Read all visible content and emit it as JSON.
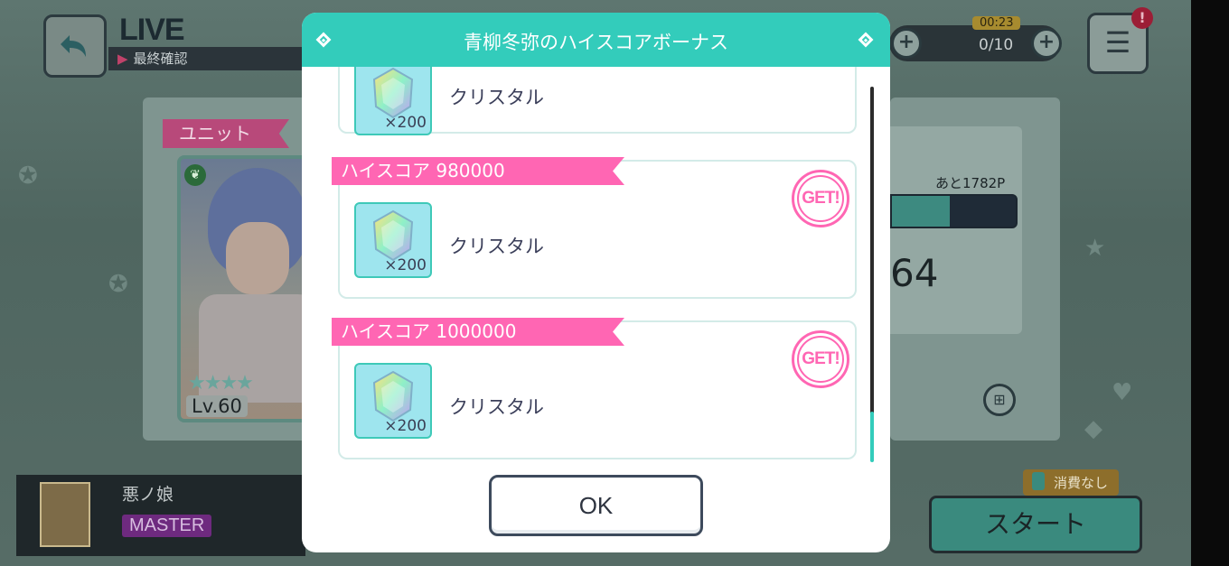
{
  "header": {
    "title": "LIVE",
    "subtitle": "最終確認",
    "timer": "00:23",
    "stamina": "0/10",
    "menu_alert": "!"
  },
  "unit": {
    "tab_label": "ユニット",
    "card_level": "Lv.60"
  },
  "score_panel": {
    "remaining": "あと1782P",
    "progress_fraction": 0.47,
    "number": "64"
  },
  "song": {
    "name": "悪ノ娘",
    "difficulty": "MASTER"
  },
  "start": {
    "label": "スタート",
    "consume_label": "消費なし"
  },
  "modal": {
    "title": "青柳冬弥のハイスコアボーナス",
    "partial_item_name": "クリスタル",
    "partial_item_qty": "×200",
    "rewards": [
      {
        "threshold": "ハイスコア 980000",
        "item_name": "クリスタル",
        "qty": "×200",
        "get_label": "GET!"
      },
      {
        "threshold": "ハイスコア 1000000",
        "item_name": "クリスタル",
        "qty": "×200",
        "get_label": "GET!"
      }
    ],
    "ok_label": "OK"
  },
  "colors": {
    "modal_header": "#33ccbb",
    "ribbon": "#ff66b3",
    "get_stamp": "#ff66b3",
    "item_bg": "#9ee5ee"
  }
}
